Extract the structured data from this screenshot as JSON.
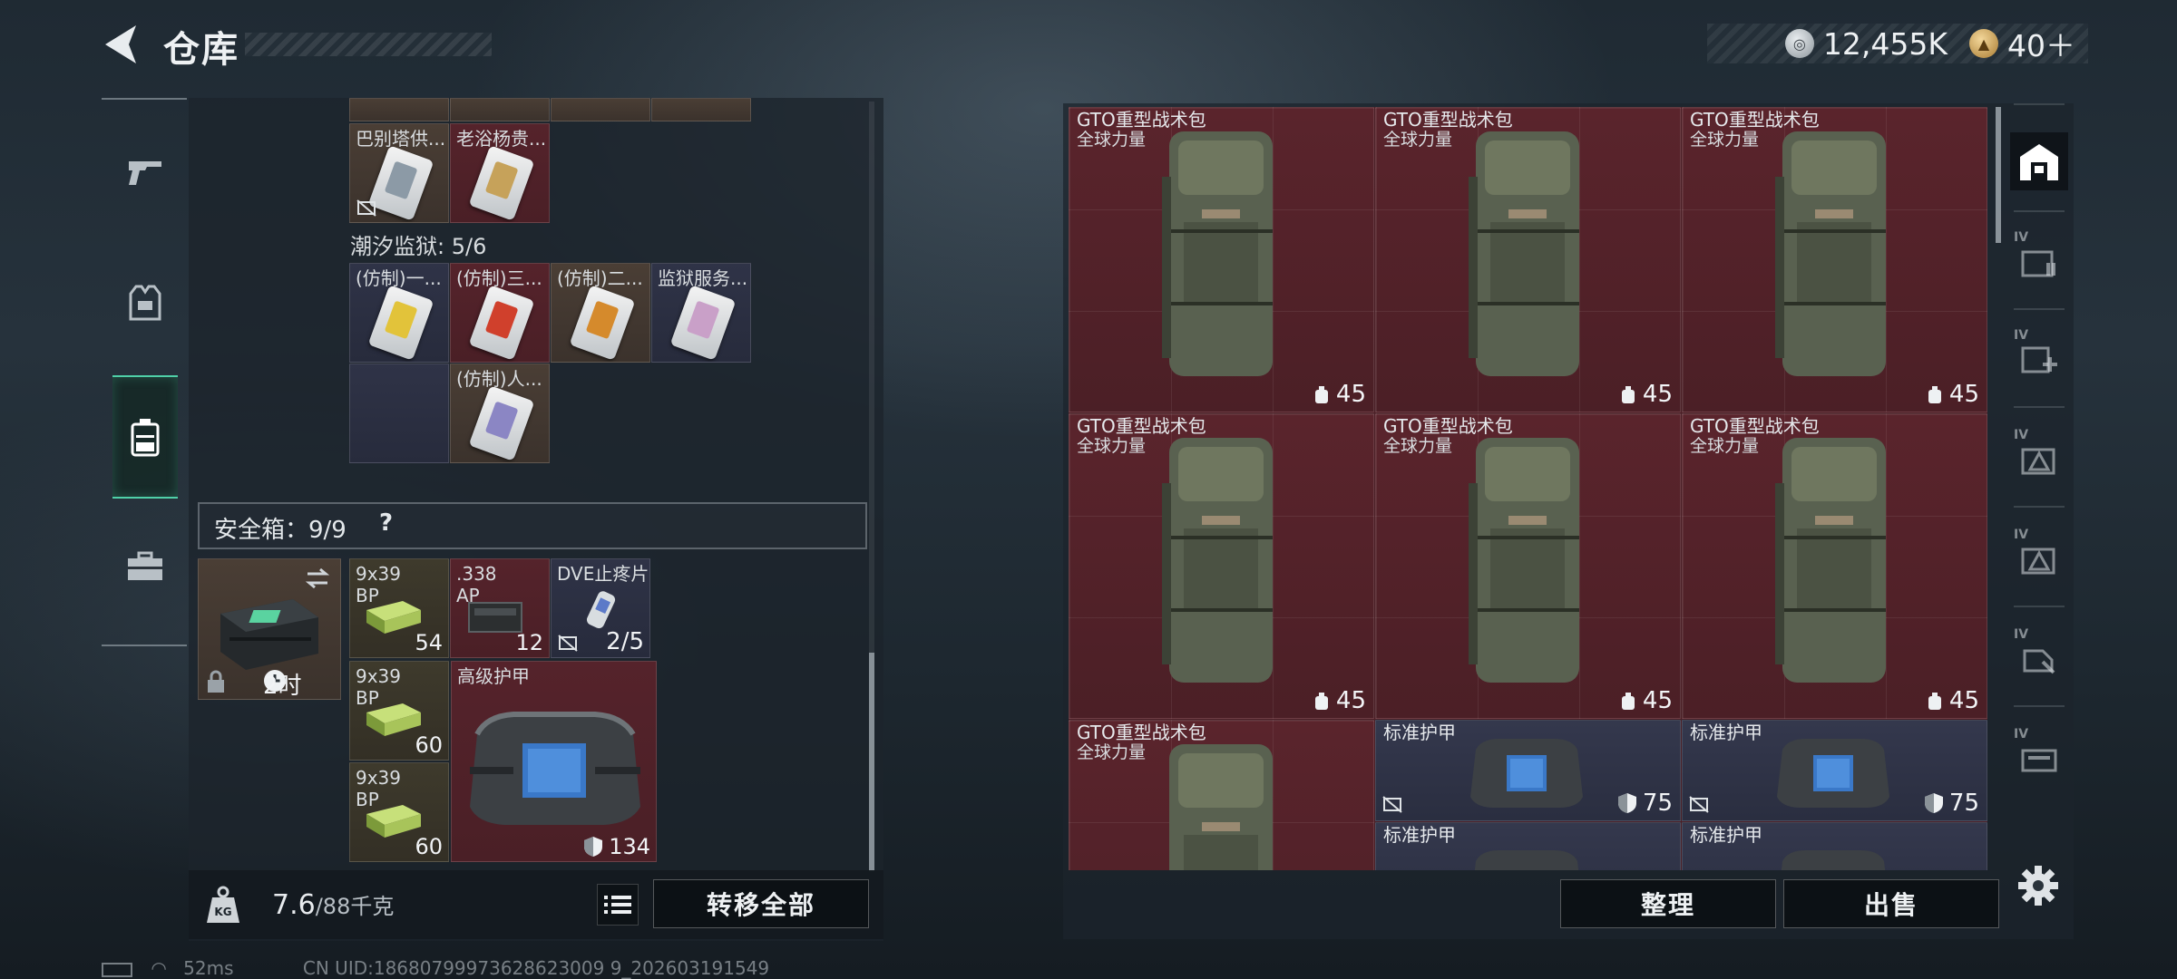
{
  "header": {
    "title": "仓库",
    "currency": [
      {
        "icon": "silver-coin-icon",
        "value": "12,455K"
      },
      {
        "icon": "gold-coin-icon",
        "value": "40＋"
      }
    ]
  },
  "left_nav": {
    "items": [
      {
        "icon": "gun-icon"
      },
      {
        "icon": "armor-vest-icon"
      },
      {
        "icon": "backpack-icon"
      },
      {
        "icon": "toolbox-icon"
      }
    ]
  },
  "inventory": {
    "top_cards": [
      {
        "label": "巴别塔供...",
        "stripe": "#8c9aa6"
      },
      {
        "label": "老浴杨贵...",
        "stripe": "#c6a25a"
      }
    ],
    "tide_label": "潮汐监狱: 5/6",
    "tide_cards": [
      {
        "label": "(仿制)一...",
        "stripe": "#e2c33a"
      },
      {
        "label": "(仿制)三...",
        "stripe": "#d0402c"
      },
      {
        "label": "(仿制)二...",
        "stripe": "#d58a2c"
      },
      {
        "label": "监狱服务...",
        "stripe": "#c9a0c8"
      },
      {
        "label": "(仿制)人...",
        "stripe": "#8b86c4"
      }
    ],
    "safe_box_label": "安全箱：9/9",
    "safe_box_help": "?",
    "case_timer": "2时",
    "safe_items": [
      {
        "label": "9x39 BP",
        "count": "54"
      },
      {
        "label": ".338 AP",
        "count": "12"
      },
      {
        "label": "DVE止疼片",
        "count": "2/5"
      },
      {
        "label": "9x39 BP",
        "count": "60"
      },
      {
        "label": "9x39 BP",
        "count": "60"
      }
    ],
    "armor_item": {
      "label": "高级护甲",
      "durability": "134"
    }
  },
  "bottom_left": {
    "weight": "7.6",
    "weight_max": "/88千克",
    "transfer_label": "转移全部"
  },
  "status_bar": {
    "ping": "52ms",
    "uid": "CN UID:18680799973628623009 9_202603191549"
  },
  "storage": {
    "bags": [
      {
        "name": "GTO重型战术包",
        "sub": "全球力量",
        "capacity": "45"
      },
      {
        "name": "GTO重型战术包",
        "sub": "全球力量",
        "capacity": "45"
      },
      {
        "name": "GTO重型战术包",
        "sub": "全球力量",
        "capacity": "45"
      },
      {
        "name": "GTO重型战术包",
        "sub": "全球力量",
        "capacity": "45"
      },
      {
        "name": "GTO重型战术包",
        "sub": "全球力量",
        "capacity": "45"
      },
      {
        "name": "GTO重型战术包",
        "sub": "全球力量",
        "capacity": "45"
      },
      {
        "name": "GTO重型战术包",
        "sub": "全球力量",
        "capacity": ""
      }
    ],
    "vests": [
      {
        "name": "标准护甲",
        "durability": "75"
      },
      {
        "name": "标准护甲",
        "durability": "75"
      },
      {
        "name": "标准护甲",
        "durability": ""
      },
      {
        "name": "标准护甲",
        "durability": ""
      }
    ]
  },
  "right_actions": {
    "tidy_label": "整理",
    "sell_label": "出售"
  },
  "right_rail": {
    "tabs": [
      {
        "icon": "storage-home-icon",
        "tier": ""
      },
      {
        "icon": "folder-stack-icon",
        "tier": "IV"
      },
      {
        "icon": "medical-plus-icon",
        "tier": "IV"
      },
      {
        "icon": "warning-box-icon",
        "tier": "IV"
      },
      {
        "icon": "warning-box-icon",
        "tier": "IV"
      },
      {
        "icon": "armor-case-icon",
        "tier": "IV"
      },
      {
        "icon": "weapon-case-icon",
        "tier": "IV"
      }
    ]
  }
}
